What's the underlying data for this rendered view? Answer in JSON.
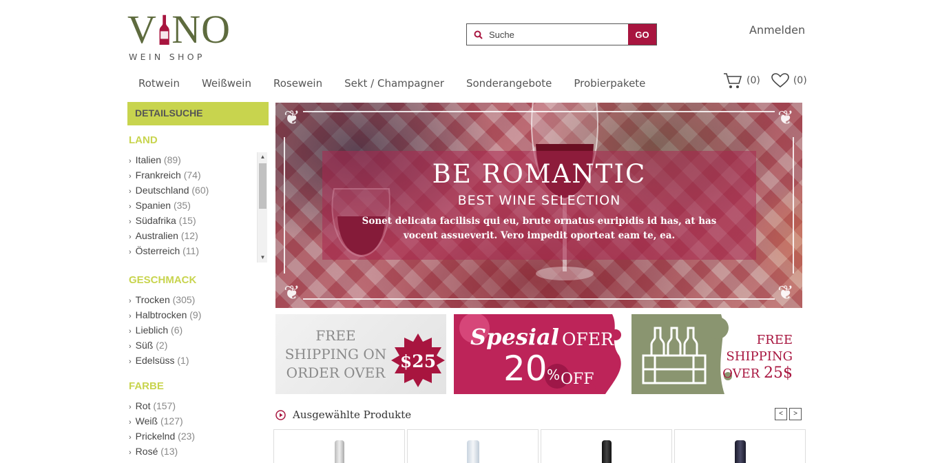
{
  "logo": {
    "main_left": "V",
    "main_right": "NO",
    "sub": "WEIN SHOP"
  },
  "search": {
    "placeholder": "Suche",
    "button": "GO"
  },
  "header": {
    "login": "Anmelden",
    "cart_count": "(0)",
    "wishlist_count": "(0)"
  },
  "nav": [
    "Rotwein",
    "Weißwein",
    "Rosewein",
    "Sekt / Champagner",
    "Sonderangebote",
    "Probierpakete"
  ],
  "sidebar": {
    "heading": "DETAILSUCHE",
    "land": {
      "title": "LAND",
      "items": [
        {
          "label": "Italien",
          "count": "(89)"
        },
        {
          "label": "Frankreich",
          "count": "(74)"
        },
        {
          "label": "Deutschland",
          "count": "(60)"
        },
        {
          "label": "Spanien",
          "count": "(35)"
        },
        {
          "label": "Südafrika",
          "count": "(15)"
        },
        {
          "label": "Australien",
          "count": "(12)"
        },
        {
          "label": "Österreich",
          "count": "(11)"
        }
      ]
    },
    "geschmack": {
      "title": "GESCHMACK",
      "items": [
        {
          "label": "Trocken",
          "count": "(305)"
        },
        {
          "label": "Halbtrocken",
          "count": "(9)"
        },
        {
          "label": "Lieblich",
          "count": "(6)"
        },
        {
          "label": "Süß",
          "count": "(2)"
        },
        {
          "label": "Edelsüss",
          "count": "(1)"
        }
      ]
    },
    "farbe": {
      "title": "FARBE",
      "items": [
        {
          "label": "Rot",
          "count": "(157)"
        },
        {
          "label": "Weiß",
          "count": "(127)"
        },
        {
          "label": "Prickelnd",
          "count": "(23)"
        },
        {
          "label": "Rosé",
          "count": "(13)"
        }
      ]
    }
  },
  "hero": {
    "title": "BE ROMANTIC",
    "subtitle": "BEST WINE SELECTION",
    "text": "Sonet delicata facilisis qui eu, brute ornatus euripidis id has, at has vocent assueverit. Vero impedit oporteat eam te, ea."
  },
  "promos": {
    "p1": {
      "text": "FREE SHIPPING ON ORDER OVER",
      "price": "$25"
    },
    "p2": {
      "script": "Spesial",
      "ofer": "OFER",
      "num": "20",
      "pct": "%",
      "off": "OFF"
    },
    "p3": {
      "l1": "FREE",
      "l2": "SHIPPING",
      "l3": "OVER",
      "l4": "25$"
    }
  },
  "featured": {
    "title": "Ausgewählte Produkte",
    "prev": "<",
    "next": ">"
  },
  "colors": {
    "accent": "#a8153f",
    "lime": "#c8d44e",
    "olive": "#5e6b3e"
  }
}
